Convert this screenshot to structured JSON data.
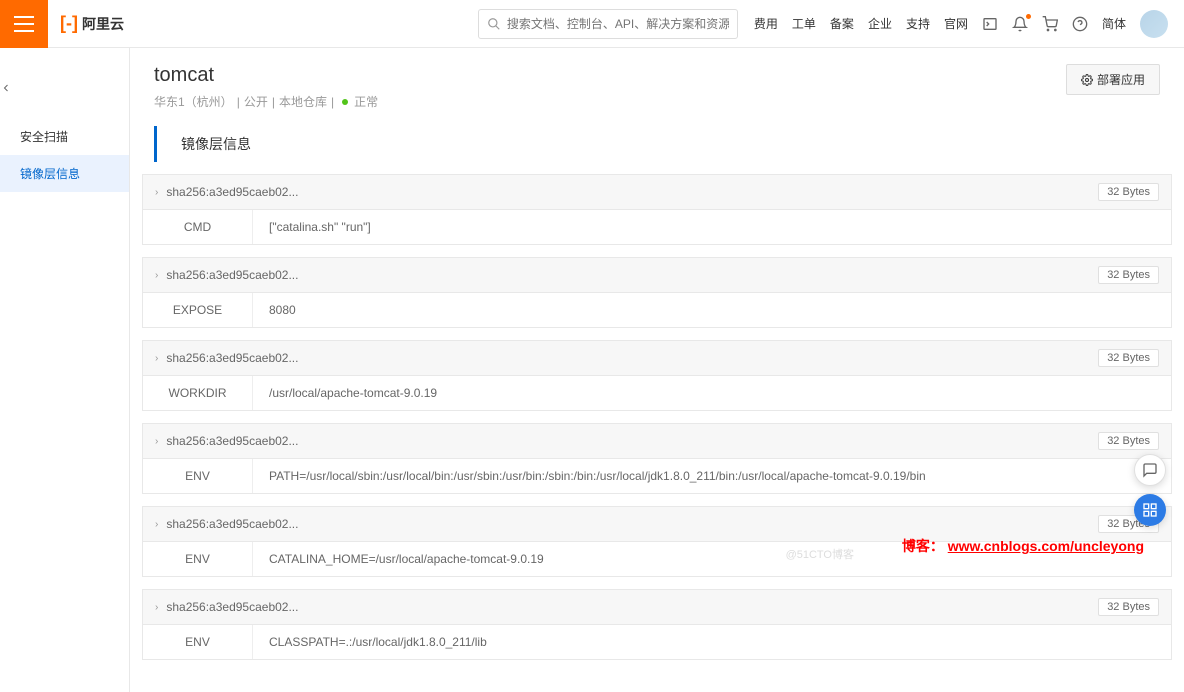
{
  "header": {
    "brand": "阿里云",
    "search_placeholder": "搜索文档、控制台、API、解决方案和资源",
    "links": {
      "fee": "费用",
      "ticket": "工单",
      "beian": "备案",
      "enterprise": "企业",
      "support": "支持",
      "website": "官网",
      "lang": "简体"
    }
  },
  "sidebar": {
    "item_scan": "安全扫描",
    "item_layers": "镜像层信息"
  },
  "page": {
    "title": "tomcat",
    "region": "华东1（杭州）",
    "visibility": "公开",
    "repo_type": "本地仓库",
    "status": "正常",
    "deploy_btn": "部署应用",
    "section_title": "镜像层信息"
  },
  "layers": [
    {
      "hash": "sha256:a3ed95caeb02...",
      "size": "32 Bytes",
      "cmd": "CMD",
      "value": "[\"catalina.sh\" \"run\"]"
    },
    {
      "hash": "sha256:a3ed95caeb02...",
      "size": "32 Bytes",
      "cmd": "EXPOSE",
      "value": "8080"
    },
    {
      "hash": "sha256:a3ed95caeb02...",
      "size": "32 Bytes",
      "cmd": "WORKDIR",
      "value": "/usr/local/apache-tomcat-9.0.19"
    },
    {
      "hash": "sha256:a3ed95caeb02...",
      "size": "32 Bytes",
      "cmd": "ENV",
      "value": "PATH=/usr/local/sbin:/usr/local/bin:/usr/sbin:/usr/bin:/sbin:/bin:/usr/local/jdk1.8.0_211/bin:/usr/local/apache-tomcat-9.0.19/bin"
    },
    {
      "hash": "sha256:a3ed95caeb02...",
      "size": "32 Bytes",
      "cmd": "ENV",
      "value": "CATALINA_HOME=/usr/local/apache-tomcat-9.0.19"
    },
    {
      "hash": "sha256:a3ed95caeb02...",
      "size": "32 Bytes",
      "cmd": "ENV",
      "value": "CLASSPATH=.:/usr/local/jdk1.8.0_211/lib"
    }
  ],
  "watermark": {
    "label": "博客：",
    "url": "www.cnblogs.com/uncleyong",
    "faint": "@51CTO博客"
  }
}
